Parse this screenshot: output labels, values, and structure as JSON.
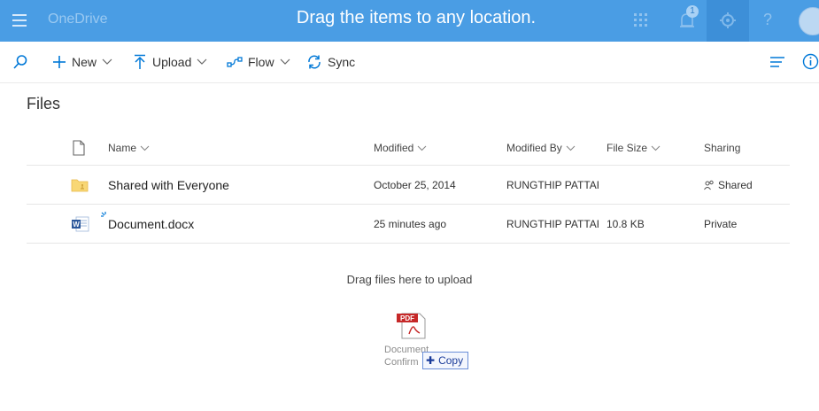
{
  "suitebar": {
    "brand": "OneDrive",
    "overlay_message": "Drag the items to any location.",
    "notification_count": "1",
    "help_label": "?"
  },
  "commands": {
    "new": "New",
    "upload": "Upload",
    "flow": "Flow",
    "sync": "Sync"
  },
  "page": {
    "title": "Files"
  },
  "table": {
    "columns": {
      "name": "Name",
      "modified": "Modified",
      "modified_by": "Modified By",
      "file_size": "File Size",
      "sharing": "Sharing"
    },
    "rows": [
      {
        "name": "Shared with Everyone",
        "modified": "October 25, 2014",
        "modified_by": "RUNGTHIP PATTAR",
        "file_size": "",
        "sharing": "Shared",
        "type": "folder"
      },
      {
        "name": "Document.docx",
        "modified": "25 minutes ago",
        "modified_by": "RUNGTHIP PATTAR",
        "file_size": "10.8 KB",
        "sharing": "Private",
        "type": "word"
      }
    ]
  },
  "upload_zone": {
    "hint": "Drag files here to upload"
  },
  "drag": {
    "caption_line1": "Document",
    "caption_line2": "Confirm",
    "copy_label": "Copy",
    "pdf_label": "PDF"
  },
  "colors": {
    "suitebar": "#4a9de4",
    "accent": "#0078d7"
  }
}
